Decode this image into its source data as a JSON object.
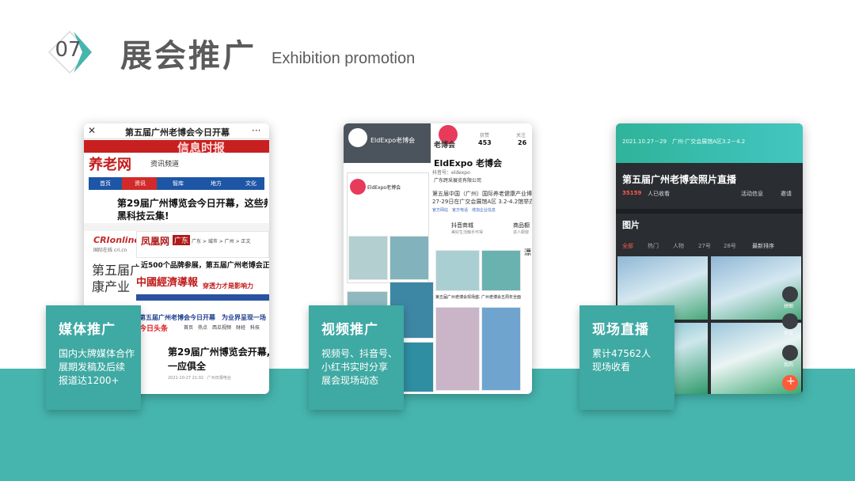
{
  "header": {
    "number": "07",
    "title": "展会推广",
    "subtitle": "Exhibition promotion"
  },
  "colors": {
    "accent": "#46b5ae",
    "card": "#3fa9a3",
    "title": "#5b5b5b"
  },
  "shot1": {
    "close": "✕",
    "headline": "第五届广州老博会今日开幕",
    "dots": "···",
    "logo": "养老网",
    "banner": "信息时报",
    "channel": "资讯频道",
    "nav": [
      "首页",
      "资讯",
      "智库",
      "地方",
      "文化"
    ],
    "article_title_1": "第29届广州博览会今日开幕，这些养老",
    "article_title_2": "黑科技云集!",
    "cri_logo": "CRIonline",
    "cri_sub": "国际在线 cri.cn",
    "ifeng_logo": "凤凰网",
    "ifeng_tag": "广东",
    "ifeng_path": "广东 > 城市 > 广州 > 正文",
    "ifeng_title": "近500个品牌参展，第五届广州老博会正式开",
    "big_text_1": "第五届广",
    "big_text_2": "康产业",
    "economy_logo": "中國經濟導報",
    "economy_slogan": "穿透力才是影响力",
    "red_title": "第五届广州老博会今日开幕　为业界呈现一场",
    "jinri": "今日头条",
    "tt_nav": "首页　热点　西瓜视频　财经　科技",
    "tt_title_1": "第29届广州博览会开幕,",
    "tt_title_2": "一应俱全",
    "tt_meta": "2021-10-27 21:02 · 广州日报电台"
  },
  "shot2": {
    "account_name": "EldExpo老博会",
    "logo_text": "老博会",
    "stat_following_label": "获赞",
    "stat_following": "453",
    "stat_fans_label": "关注",
    "stat_fans": "26",
    "title": "EldExpo 老博会",
    "douyin_id": "抖音号：eldexpo",
    "company": "广东跨采展览有限公司",
    "desc_1": "第五届中国（广州）国际养老健康产业博",
    "desc_2": "27-29日在广交会展馆A区 3.2-4.2馆举办,",
    "tags": "官方网站　官方电话　增加企业信息",
    "mall": "抖音商城",
    "mall_sub": "美好生活触手可得",
    "goods": "商品橱",
    "goods_sub": "进人橱窗",
    "play_labels": [
      "第五届广州老博会现场盛况!",
      "广州老博会五周年全面升级,打造康养服务"
    ],
    "extra": "漂"
  },
  "shot3": {
    "top_bar": "2021.10.27－29　广州·广交会展馆A区3.2－4.2",
    "title": "第五届广州老博会照片直播",
    "viewers_num": "35159",
    "viewers_label": "人已收看",
    "events": "活动信息",
    "invite": "邀请",
    "section": "图片",
    "tabs": [
      "全部",
      "热门",
      "人物",
      "27号",
      "28号",
      "最新排序"
    ],
    "side_btns": [
      "拼图",
      "评论",
      "我的"
    ],
    "fab": "+"
  },
  "cards": [
    {
      "title": "媒体推广",
      "lines": [
        "国内大牌媒体合作",
        "展期发稿及后续",
        "报道达1200+"
      ]
    },
    {
      "title": "视频推广",
      "lines": [
        "视频号、抖音号、",
        "小红书实时分享",
        "展会现场动态"
      ]
    },
    {
      "title": "现场直播",
      "lines": [
        "累计47562人",
        "现场收看"
      ]
    }
  ]
}
